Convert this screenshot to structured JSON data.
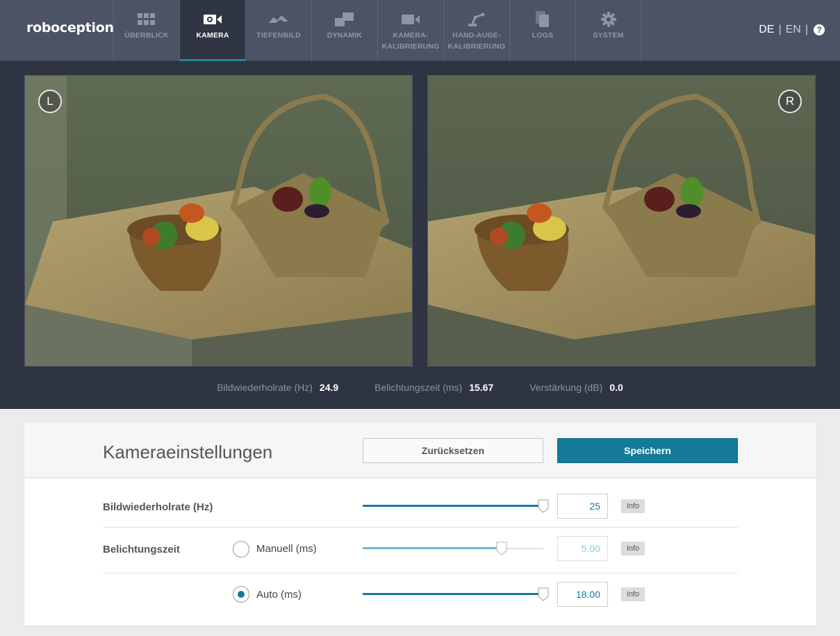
{
  "brand": "roboception",
  "nav": {
    "items": [
      {
        "label": "ÜBERBLICK",
        "icon": "grid-icon"
      },
      {
        "label": "KAMERA",
        "icon": "camera-icon",
        "active": true
      },
      {
        "label": "TIEFENBILD",
        "icon": "depth-icon"
      },
      {
        "label": "DYNAMIK",
        "icon": "dynamics-icon"
      },
      {
        "label": "KAMERA-\nKALIBRIERUNG",
        "icon": "calibration-camera-icon"
      },
      {
        "label": "HAND-AUGE-\nKALIBRIERUNG",
        "icon": "robot-arm-icon"
      },
      {
        "label": "LOGS",
        "icon": "document-icon"
      },
      {
        "label": "SYSTEM",
        "icon": "gear-icon"
      }
    ]
  },
  "lang": {
    "de": "DE",
    "sep": "|",
    "en": "EN",
    "help": "?"
  },
  "viewer": {
    "left_badge": "L",
    "right_badge": "R"
  },
  "stats": {
    "framerate_label": "Bildwiederholrate (Hz)",
    "framerate_value": "24.9",
    "exposure_label": "Belichtungszeit (ms)",
    "exposure_value": "15.67",
    "gain_label": "Verstärkung (dB)",
    "gain_value": "0.0"
  },
  "settings": {
    "title": "Kameraeinstellungen",
    "reset_label": "Zurücksetzen",
    "save_label": "Speichern",
    "fps": {
      "label": "Bildwiederholrate (Hz)",
      "value": "25",
      "slider_fraction": 1.0,
      "info": "Info"
    },
    "exposure": {
      "label": "Belichtungszeit",
      "manual": {
        "label": "Manuell (ms)",
        "value": "5.00",
        "slider_fraction": 0.77,
        "checked": false,
        "info": "Info"
      },
      "auto": {
        "label": "Auto (ms)",
        "value": "18.00",
        "slider_fraction": 1.0,
        "checked": true,
        "info": "Info"
      }
    }
  },
  "colors": {
    "accent": "#137b98",
    "header": "#4b5364",
    "viewer_bg": "#2e3441"
  }
}
